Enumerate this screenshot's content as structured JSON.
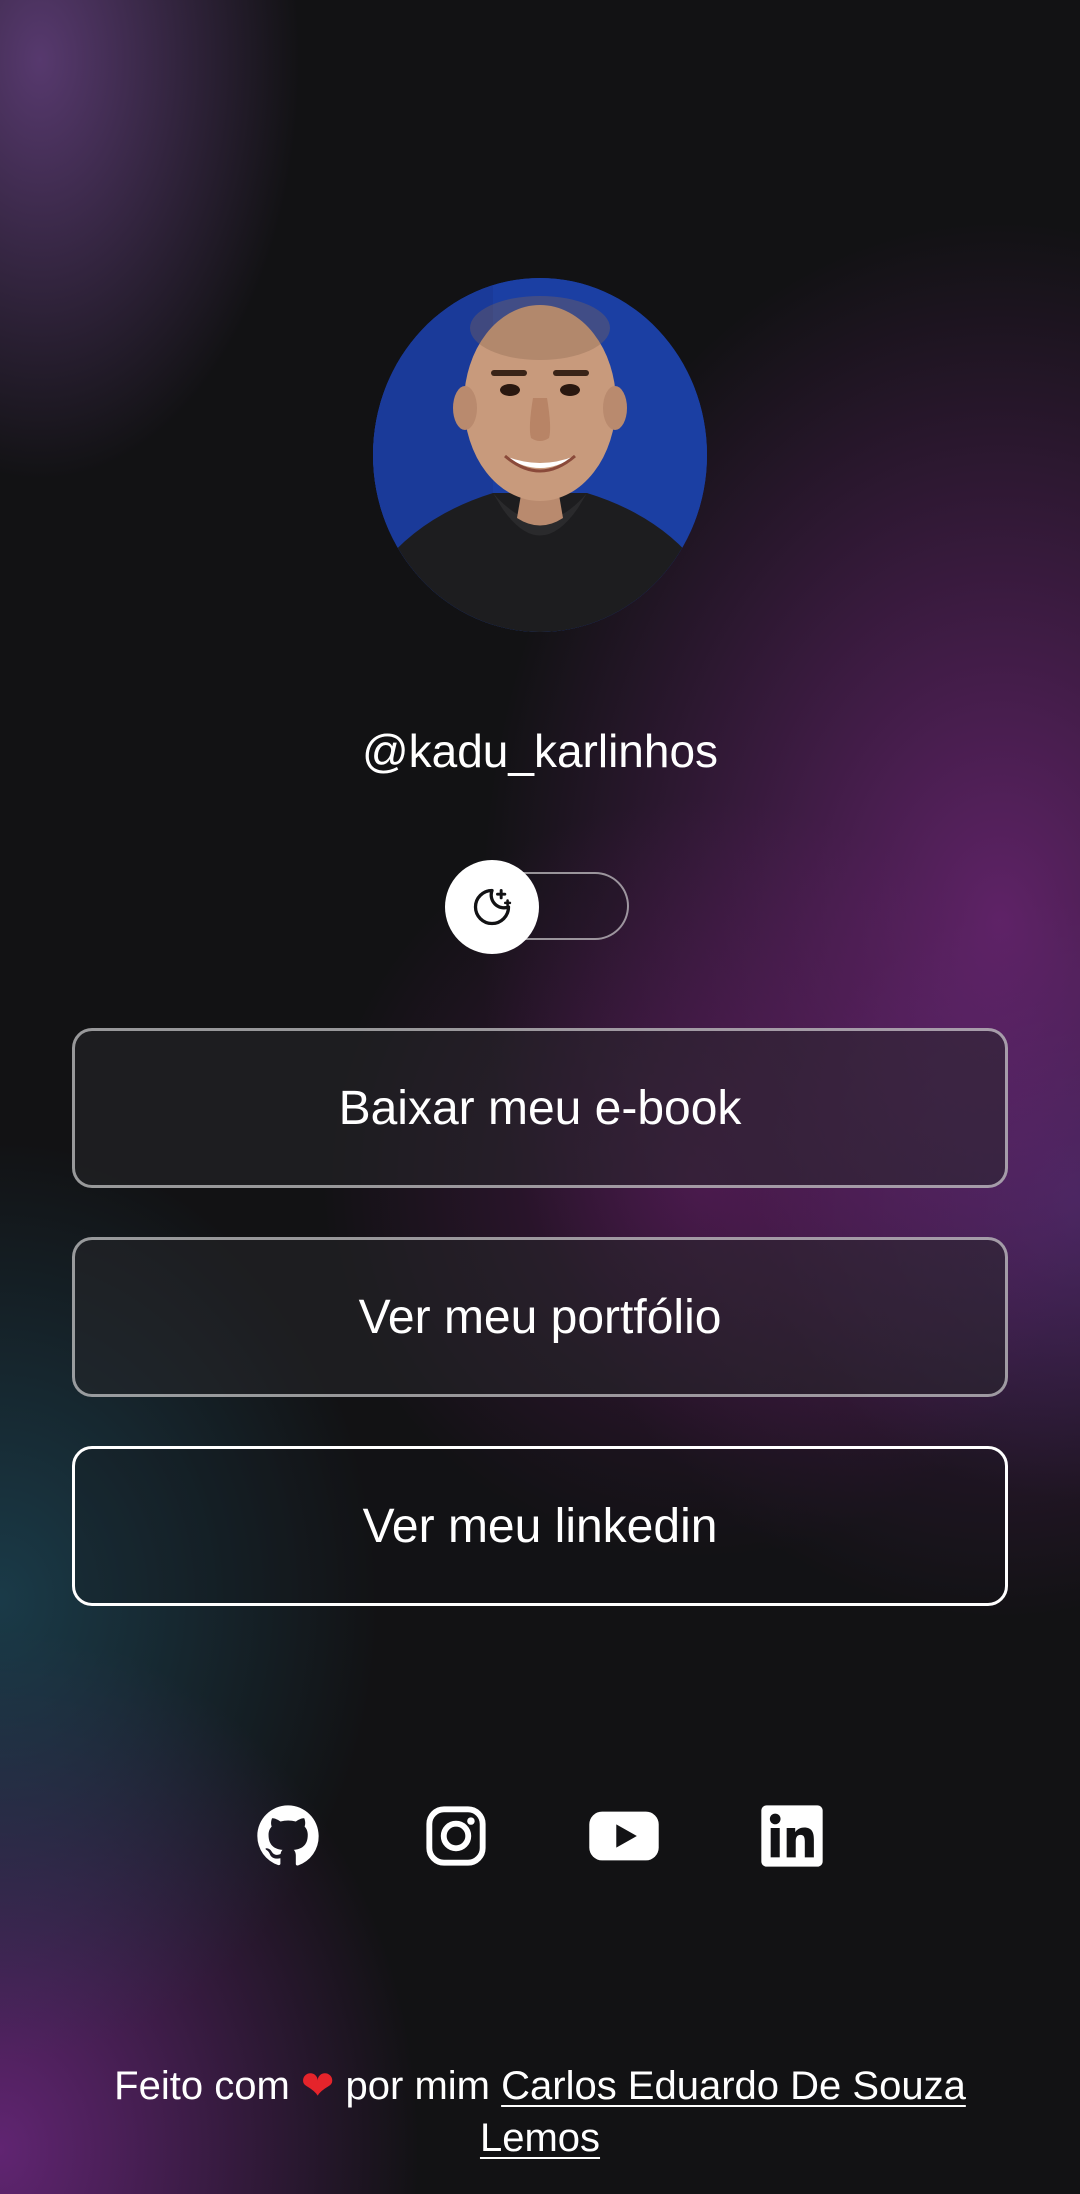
{
  "profile": {
    "handle": "@kadu_karlinhos",
    "avatar_icon": "profile-photo"
  },
  "theme_toggle": {
    "icon": "moon-stars-icon",
    "state": "dark"
  },
  "links": [
    {
      "label": "Baixar meu e-book"
    },
    {
      "label": "Ver meu portfólio"
    },
    {
      "label": "Ver meu linkedin"
    }
  ],
  "socials": [
    {
      "icon": "github-icon"
    },
    {
      "icon": "instagram-icon"
    },
    {
      "icon": "youtube-icon"
    },
    {
      "icon": "linkedin-icon"
    }
  ],
  "footer": {
    "prefix": "Feito com",
    "heart": "❤",
    "middle": "por mim",
    "author": "Carlos Eduardo De Souza Lemos"
  },
  "colors": {
    "background": "#121214",
    "text": "#ffffff",
    "heart": "#e5242b",
    "avatar_bg": "#1b3fa3"
  }
}
